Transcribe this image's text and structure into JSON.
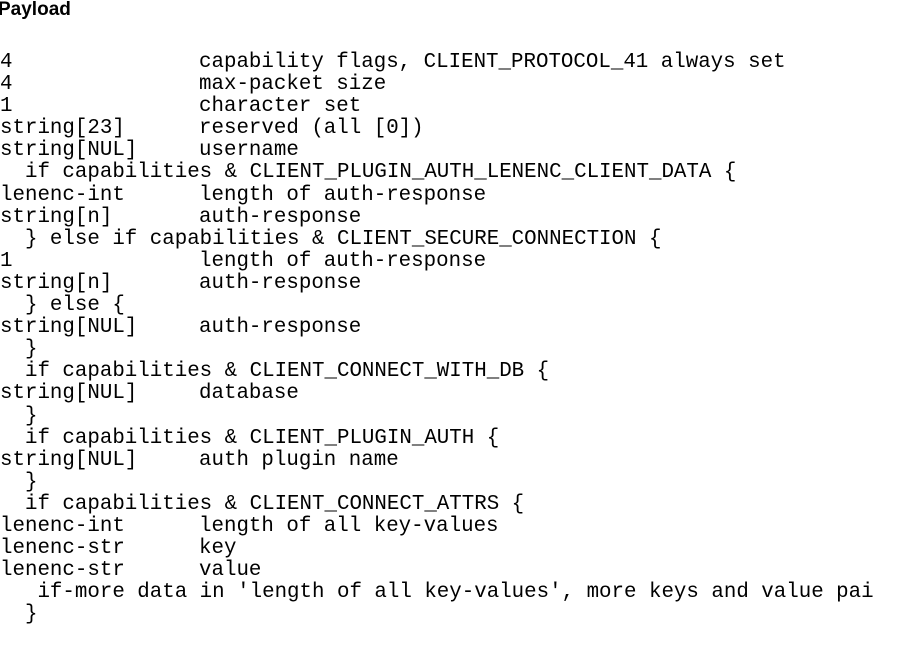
{
  "heading": "Payload",
  "lines": [
    {
      "kind": "field",
      "type": "4",
      "desc": "capability flags, CLIENT_PROTOCOL_41 always set"
    },
    {
      "kind": "field",
      "type": "4",
      "desc": "max-packet size"
    },
    {
      "kind": "field",
      "type": "1",
      "desc": "character set"
    },
    {
      "kind": "field",
      "type": "string[23]",
      "desc": "reserved (all [0])"
    },
    {
      "kind": "field",
      "type": "string[NUL]",
      "desc": "username"
    },
    {
      "kind": "cond",
      "text": "  if capabilities & CLIENT_PLUGIN_AUTH_LENENC_CLIENT_DATA {"
    },
    {
      "kind": "field",
      "type": "lenenc-int",
      "desc": "length of auth-response"
    },
    {
      "kind": "field",
      "type": "string[n]",
      "desc": "auth-response"
    },
    {
      "kind": "cond",
      "text": "  } else if capabilities & CLIENT_SECURE_CONNECTION {"
    },
    {
      "kind": "field",
      "type": "1",
      "desc": "length of auth-response"
    },
    {
      "kind": "field",
      "type": "string[n]",
      "desc": "auth-response"
    },
    {
      "kind": "cond",
      "text": "  } else {"
    },
    {
      "kind": "field",
      "type": "string[NUL]",
      "desc": "auth-response"
    },
    {
      "kind": "cond",
      "text": "  }"
    },
    {
      "kind": "cond",
      "text": "  if capabilities & CLIENT_CONNECT_WITH_DB {"
    },
    {
      "kind": "field",
      "type": "string[NUL]",
      "desc": "database"
    },
    {
      "kind": "cond",
      "text": "  }"
    },
    {
      "kind": "cond",
      "text": "  if capabilities & CLIENT_PLUGIN_AUTH {"
    },
    {
      "kind": "field",
      "type": "string[NUL]",
      "desc": "auth plugin name"
    },
    {
      "kind": "cond",
      "text": "  }"
    },
    {
      "kind": "cond",
      "text": "  if capabilities & CLIENT_CONNECT_ATTRS {"
    },
    {
      "kind": "field",
      "type": "lenenc-int",
      "desc": "length of all key-values"
    },
    {
      "kind": "field",
      "type": "lenenc-str",
      "desc": "key"
    },
    {
      "kind": "field",
      "type": "lenenc-str",
      "desc": "value"
    },
    {
      "kind": "cond",
      "text": "   if-more data in 'length of all key-values', more keys and value pai"
    },
    {
      "kind": "cond",
      "text": "  }"
    }
  ]
}
